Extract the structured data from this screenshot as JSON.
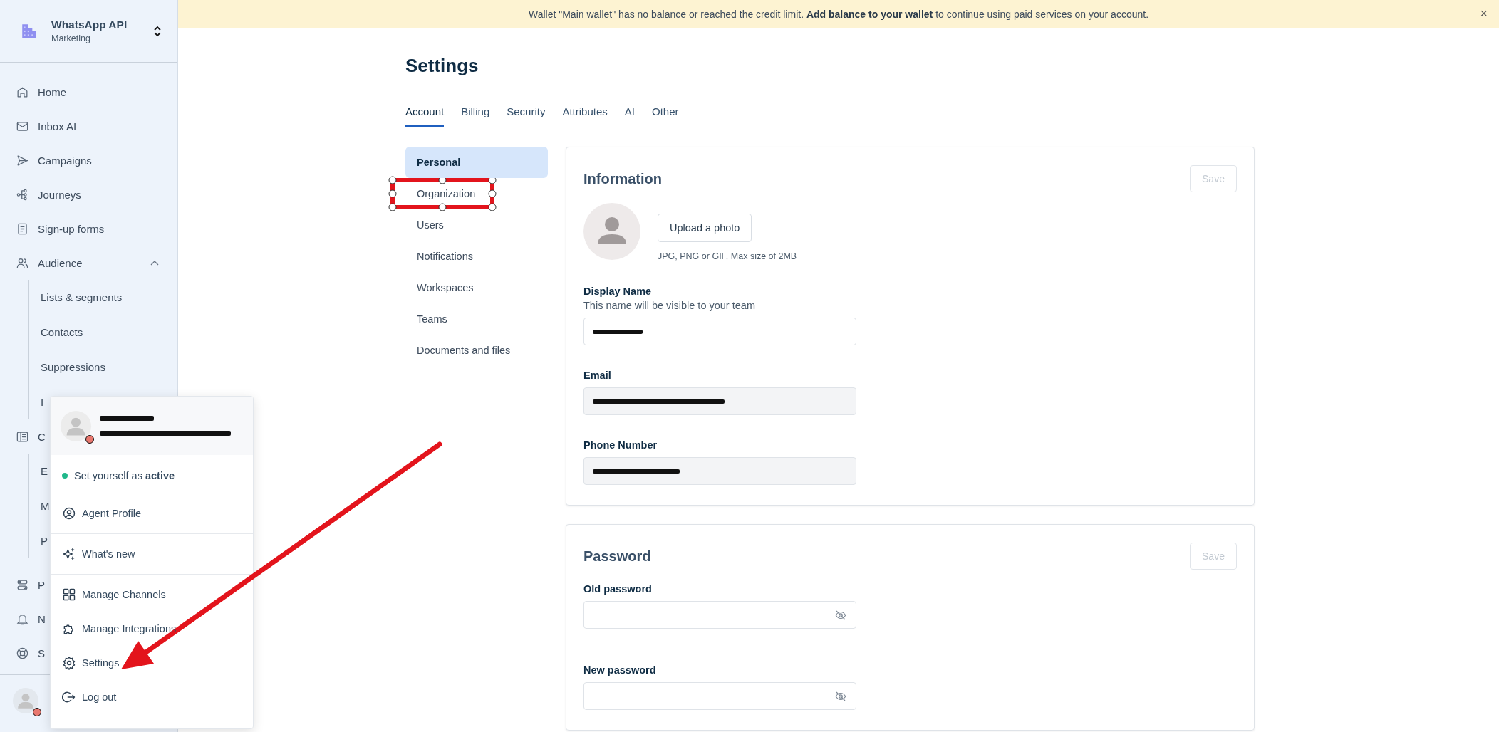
{
  "workspace": {
    "name": "WhatsApp API",
    "subtitle": "Marketing"
  },
  "banner": {
    "text_before": "Wallet \"Main wallet\" has no balance or reached the credit limit.",
    "link": "Add balance to your wallet",
    "text_after": "to continue using paid services on your account.",
    "close": "×"
  },
  "sidebar": {
    "items": [
      {
        "label": "Home"
      },
      {
        "label": "Inbox AI"
      },
      {
        "label": "Campaigns"
      },
      {
        "label": "Journeys"
      },
      {
        "label": "Sign-up forms"
      },
      {
        "label": "Audience",
        "expanded": true,
        "children": [
          {
            "label": "Lists & segments"
          },
          {
            "label": "Contacts"
          },
          {
            "label": "Suppressions"
          },
          {
            "label": "I"
          }
        ]
      },
      {
        "label": "C",
        "children": [
          {
            "label": "E"
          },
          {
            "label": "M"
          },
          {
            "label": "P"
          }
        ]
      }
    ],
    "bottom_items": [
      {
        "label": "P"
      },
      {
        "label": "N"
      },
      {
        "label": "S"
      }
    ],
    "user": {
      "active": false
    }
  },
  "user_menu": {
    "user": {
      "active": false,
      "redacted": true
    },
    "status_action": "Set yourself as **active**",
    "groups": [
      {
        "items": [
          {
            "label": "Agent Profile"
          }
        ]
      },
      {
        "items": [
          {
            "label": "What's new"
          }
        ]
      },
      {
        "items": [
          {
            "label": "Manage Channels"
          },
          {
            "label": "Manage Integrations"
          },
          {
            "label": "Settings"
          },
          {
            "label": "Log out"
          }
        ]
      }
    ]
  },
  "settings": {
    "title": "Settings",
    "tabs": [
      {
        "label": "Account",
        "selected": true
      },
      {
        "label": "Billing",
        "selected": false
      },
      {
        "label": "Security",
        "selected": false
      },
      {
        "label": "Attributes",
        "selected": false
      },
      {
        "label": "AI",
        "selected": false
      },
      {
        "label": "Other",
        "selected": false
      }
    ],
    "submenu": [
      {
        "label": "Personal",
        "selected": true,
        "highlighted": false
      },
      {
        "label": "Organization",
        "selected": false,
        "highlighted": true
      },
      {
        "label": "Users",
        "selected": false,
        "highlighted": false
      },
      {
        "label": "Notifications",
        "selected": false,
        "highlighted": false
      },
      {
        "label": "Workspaces",
        "selected": false,
        "highlighted": false
      },
      {
        "label": "Teams",
        "selected": false,
        "highlighted": false
      },
      {
        "label": "Documents and files",
        "selected": false,
        "highlighted": false
      }
    ],
    "information": {
      "title": "Information",
      "save": {
        "label": "Save",
        "disabled": true
      },
      "upload": "Upload a photo",
      "hint": "JPG, PNG or GIF. Max size of 2MB",
      "fields": [
        {
          "label": "Display Name",
          "help": "This name will be visible to your team",
          "readonly": false,
          "redacted": true
        },
        {
          "label": "Email",
          "readonly": true,
          "redacted": true
        },
        {
          "label": "Phone Number",
          "readonly": true,
          "redacted": true
        }
      ]
    },
    "password": {
      "title": "Password",
      "save": {
        "label": "Save",
        "disabled": true
      },
      "fields": [
        {
          "kind": "password",
          "label": "Old password",
          "readonly": false
        },
        {
          "kind": "password",
          "label": "New password",
          "readonly": false
        }
      ]
    }
  },
  "arrow_annotation": true
}
